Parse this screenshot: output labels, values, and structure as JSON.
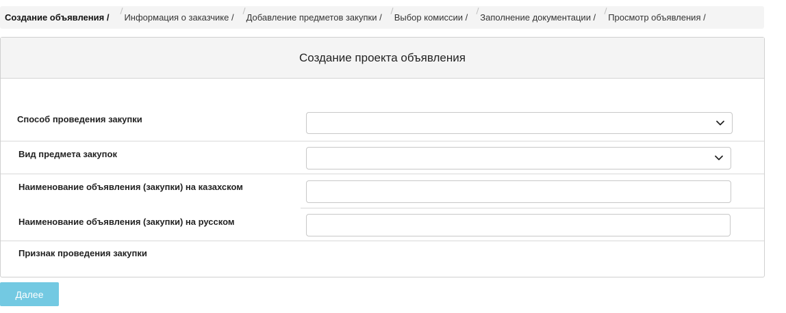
{
  "breadcrumb": {
    "items": [
      {
        "label": "Создание объявления /",
        "active": true
      },
      {
        "label": "Информация о заказчике  /",
        "active": false
      },
      {
        "label": "Добавление предметов закупки /",
        "active": false
      },
      {
        "label": "Выбор комиссии /",
        "active": false
      },
      {
        "label": "Заполнение документации /",
        "active": false
      },
      {
        "label": "Просмотр объявления /",
        "active": false
      }
    ]
  },
  "panel": {
    "title": "Создание проекта объявления",
    "fields": [
      {
        "label": "Способ проведения закупки",
        "type": "select",
        "value": ""
      },
      {
        "label": "Вид предмета закупок",
        "type": "select",
        "value": ""
      },
      {
        "label": "Наименование объявления (закупки) на казахском",
        "type": "text",
        "value": ""
      },
      {
        "label": "Наименование объявления (закупки) на русском",
        "type": "text",
        "value": ""
      },
      {
        "label": "Признак проведения закупки",
        "type": "none",
        "value": ""
      }
    ]
  },
  "actions": {
    "next_label": "Далее"
  },
  "colors": {
    "accent": "#5bc0de",
    "header_bg": "#f4f4f4",
    "border": "#cfcfcf"
  },
  "icons": {
    "select_arrow": "chevron-down-icon"
  }
}
